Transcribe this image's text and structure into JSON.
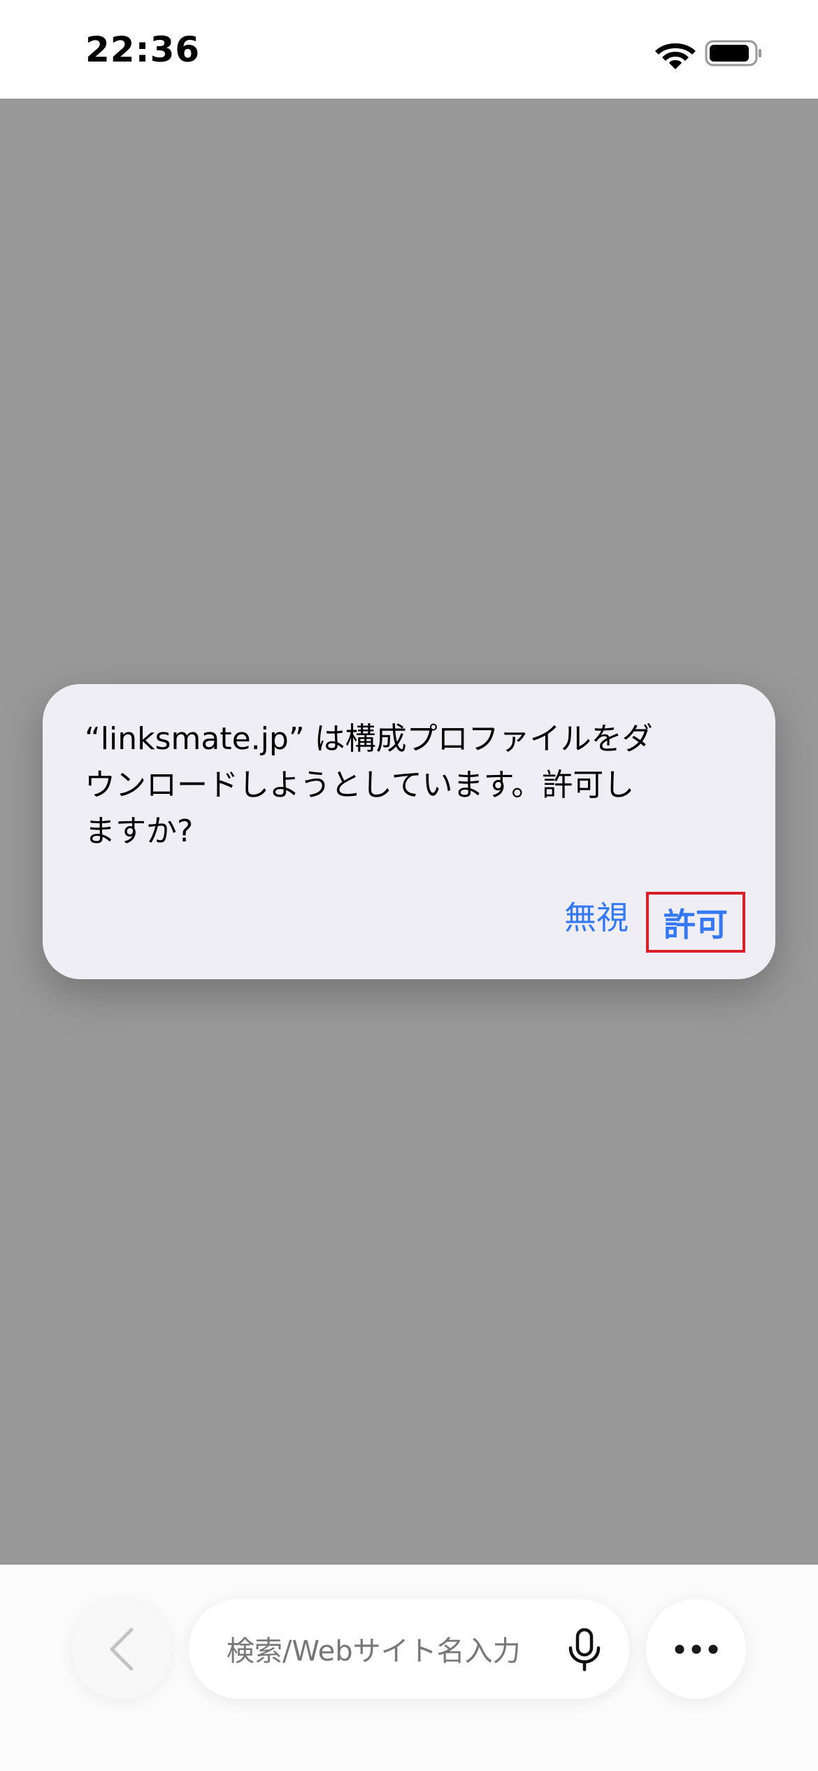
{
  "status_bar": {
    "time": "22:36",
    "icons": [
      "wifi-icon",
      "battery-icon"
    ]
  },
  "dialog": {
    "message": "“linksmate.jp” は構成プロファイルをダ\nウンロードしようとしています。許可し\nますか?",
    "ignore_label": "無視",
    "allow_label": "許可",
    "button_color": "#3478f6",
    "highlight_color": "#d9202a"
  },
  "bottom_toolbar": {
    "back_icon": "chevron-left-icon",
    "search_placeholder": "検索/Webサイト名入力",
    "mic_icon": "microphone-icon",
    "more_icon": "ellipsis-icon"
  }
}
